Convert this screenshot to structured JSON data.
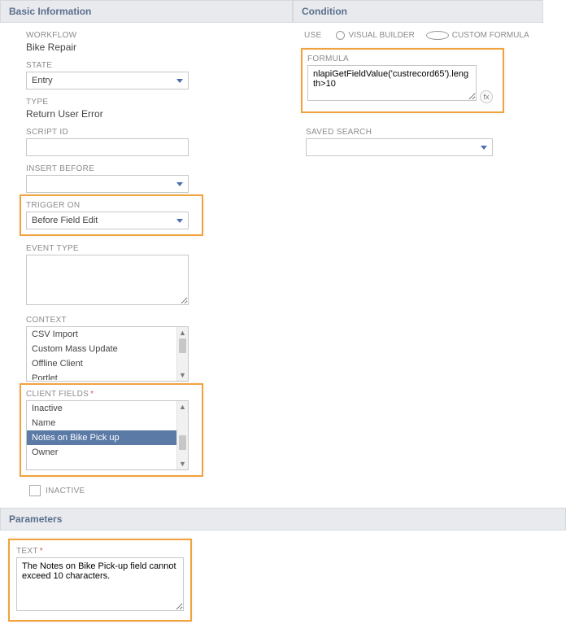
{
  "basic": {
    "header": "Basic Information",
    "workflow_label": "WORKFLOW",
    "workflow_value": "Bike Repair",
    "state_label": "STATE",
    "state_value": "Entry",
    "type_label": "TYPE",
    "type_value": "Return User Error",
    "scriptid_label": "SCRIPT ID",
    "scriptid_value": "",
    "insert_before_label": "INSERT BEFORE",
    "insert_before_value": "",
    "trigger_on_label": "TRIGGER ON",
    "trigger_on_value": "Before Field Edit",
    "event_type_label": "EVENT TYPE",
    "event_type_value": "",
    "context_label": "CONTEXT",
    "context_items": [
      "CSV Import",
      "Custom Mass Update",
      "Offline Client",
      "Portlet"
    ],
    "client_fields_label": "CLIENT FIELDS",
    "client_fields_items": [
      "Inactive",
      "Name",
      "Notes on Bike Pick up",
      "Owner"
    ],
    "client_fields_selected": "Notes on Bike Pick up",
    "inactive_label": "INACTIVE"
  },
  "condition": {
    "header": "Condition",
    "use_label": "USE",
    "visual_builder_label": "VISUAL BUILDER",
    "custom_formula_label": "CUSTOM FORMULA",
    "formula_label": "FORMULA",
    "formula_value": "nlapiGetFieldValue('custrecord65').length>10",
    "saved_search_label": "SAVED SEARCH",
    "saved_search_value": ""
  },
  "parameters": {
    "header": "Parameters",
    "text_label": "TEXT",
    "text_value": "The Notes on Bike Pick-up field cannot exceed 10 characters."
  }
}
